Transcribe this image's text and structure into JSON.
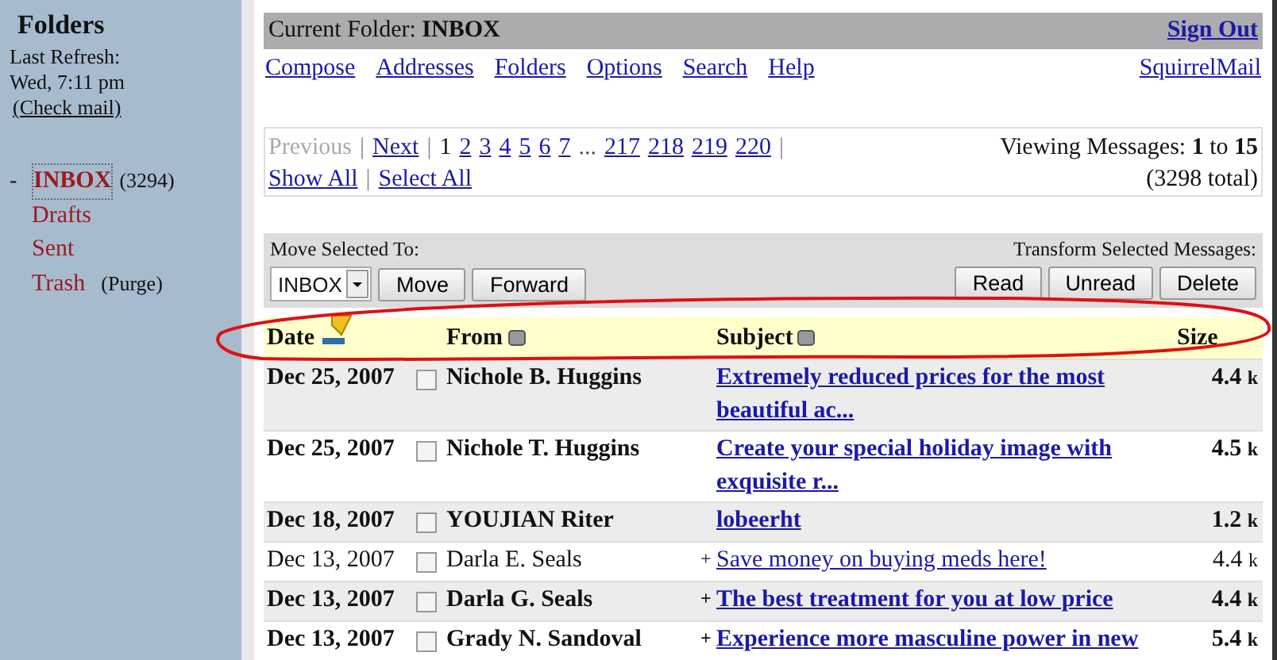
{
  "sidebar": {
    "title": "Folders",
    "refresh_label": "Last Refresh:",
    "refresh_time": "Wed, 7:11 pm",
    "check_mail": "(Check mail)",
    "collapse": "-",
    "folders": [
      {
        "name": "INBOX",
        "count": "(3294)",
        "selected": true
      },
      {
        "name": "Drafts",
        "selected": false
      },
      {
        "name": "Sent",
        "selected": false
      },
      {
        "name": "Trash",
        "action": "(Purge)",
        "selected": false
      }
    ]
  },
  "header": {
    "label": "Current Folder:",
    "folder": "INBOX",
    "sign_out": "Sign Out"
  },
  "nav": {
    "links": [
      "Compose",
      "Addresses",
      "Folders",
      "Options",
      "Search",
      "Help"
    ],
    "brand": "SquirrelMail"
  },
  "pagination": {
    "separator": "|",
    "previous": "Previous",
    "next": "Next",
    "pages": [
      {
        "label": "1",
        "selected": true
      },
      {
        "label": "2",
        "selected": false
      },
      {
        "label": "3",
        "selected": false
      },
      {
        "label": "4",
        "selected": false
      },
      {
        "label": "5",
        "selected": false
      },
      {
        "label": "6",
        "selected": false
      },
      {
        "label": "7",
        "selected": false
      },
      {
        "label": "...",
        "kind": "gap"
      },
      {
        "label": "217",
        "selected": false
      },
      {
        "label": "218",
        "selected": false
      },
      {
        "label": "219",
        "selected": false
      },
      {
        "label": "220",
        "selected": false
      }
    ],
    "show_all": "Show All",
    "select_all": "Select All",
    "viewing_label": "Viewing Messages:",
    "from": "1",
    "to_word": "to",
    "to": "15",
    "total": "(3298 total)"
  },
  "toolbar": {
    "move_label": "Move Selected To:",
    "folder_value": "INBOX",
    "move_buttons": [
      "Move",
      "Forward"
    ],
    "transform_label": "Transform Selected Messages:",
    "transform_buttons": [
      "Read",
      "Unread",
      "Delete"
    ]
  },
  "columns": [
    "Date",
    "From",
    "Subject",
    "Size"
  ],
  "rows": [
    {
      "date": "Dec 25, 2007",
      "checked": false,
      "from": "Nichole B. Huggins",
      "subject": "Extremely reduced prices for the most beautiful ac...",
      "size": "4.4",
      "unit": "k",
      "unread": true
    },
    {
      "date": "Dec 25, 2007",
      "checked": false,
      "from": "Nichole T. Huggins",
      "subject": "Create your special holiday image with exquisite r...",
      "size": "4.5",
      "unit": "k",
      "unread": true
    },
    {
      "date": "Dec 18, 2007",
      "checked": false,
      "from": "YOUJIAN Riter",
      "subject": "lobeerht",
      "size": "1.2",
      "unit": "k",
      "unread": true
    },
    {
      "date": "Dec 13, 2007",
      "checked": false,
      "from": "Darla E. Seals",
      "flag": "+",
      "subject": "Save money on buying meds here!",
      "size": "4.4",
      "unit": "k",
      "unread": false
    },
    {
      "date": "Dec 13, 2007",
      "checked": false,
      "from": "Darla G. Seals",
      "flag": "+",
      "subject": "The best treatment for you at low price",
      "size": "4.4",
      "unit": "k",
      "unread": true
    },
    {
      "date": "Dec 13, 2007",
      "checked": false,
      "from": "Grady N. Sandoval",
      "flag": "+",
      "subject": "Experience more masculine power in new",
      "size": "5.4",
      "unit": "k",
      "unread": true
    }
  ]
}
